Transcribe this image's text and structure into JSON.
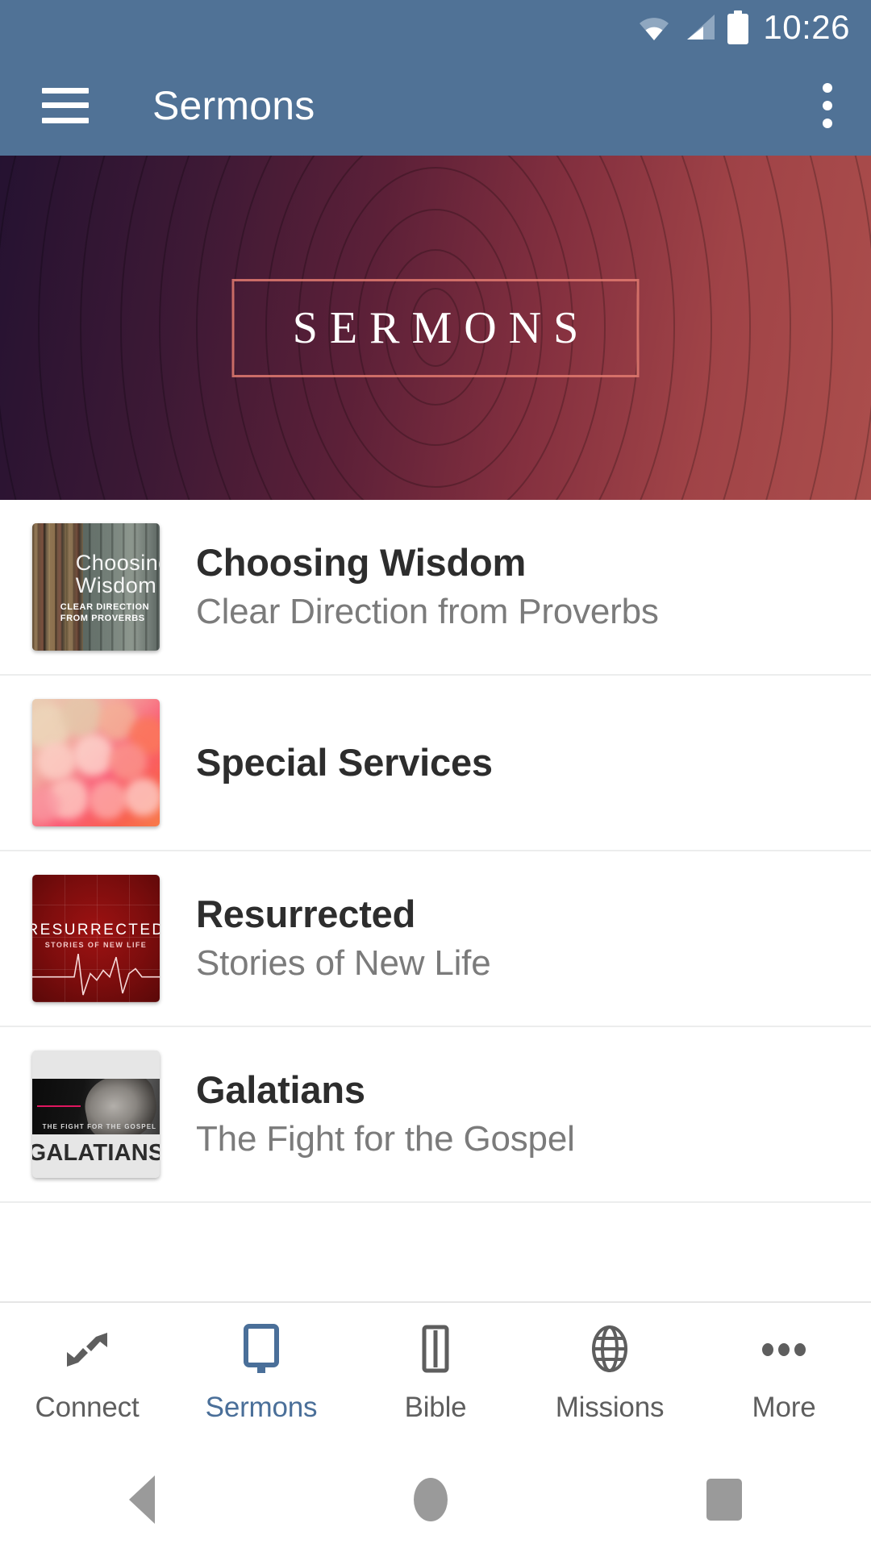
{
  "status_bar": {
    "time": "10:26",
    "icons": [
      "wifi-icon",
      "cellular-signal-icon",
      "battery-icon"
    ]
  },
  "app_bar": {
    "title": "Sermons",
    "menu_icon": "hamburger-menu-icon",
    "overflow_icon": "overflow-menu-icon",
    "background_color": "#507296"
  },
  "hero": {
    "title": "SERMONS",
    "gradient_from": "#251231",
    "gradient_to": "#ab4e4c",
    "frame_color": "#e27a70"
  },
  "series": [
    {
      "title": "Choosing Wisdom",
      "subtitle": "Clear Direction from Proverbs",
      "thumb_name": "thumbnail-choosing-wisdom",
      "thumb_overlay_title": "Choosing\nWisdom",
      "thumb_overlay_line1": "Choosing",
      "thumb_overlay_line2": "Wisdom",
      "thumb_overlay_sub": "CLEAR DIRECTION\nFROM PROVERBS"
    },
    {
      "title": "Special Services",
      "subtitle": "",
      "thumb_name": "thumbnail-special-services"
    },
    {
      "title": "Resurrected",
      "subtitle": "Stories of New Life",
      "thumb_name": "thumbnail-resurrected",
      "thumb_overlay_title": "RESURRECTED",
      "thumb_overlay_sub": "STORIES OF NEW LIFE"
    },
    {
      "title": "Galatians",
      "subtitle": "The Fight for the Gospel",
      "thumb_name": "thumbnail-galatians",
      "thumb_overlay_title": "GALATIANS",
      "thumb_overlay_sub": "THE FIGHT FOR THE GOSPEL"
    }
  ],
  "tabs": [
    {
      "label": "Connect",
      "icon": "connect-arrows-icon",
      "active": false
    },
    {
      "label": "Sermons",
      "icon": "monitor-screen-icon",
      "active": true
    },
    {
      "label": "Bible",
      "icon": "open-book-icon",
      "active": false
    },
    {
      "label": "Missions",
      "icon": "globe-icon",
      "active": false
    },
    {
      "label": "More",
      "icon": "ellipsis-icon",
      "active": false
    }
  ],
  "active_tab_color": "#4a6f99",
  "inactive_tab_color": "#5e5e5e",
  "android_nav": {
    "back": "back-button",
    "home": "home-button",
    "recents": "recents-button"
  }
}
